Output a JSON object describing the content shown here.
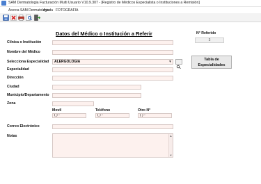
{
  "window": {
    "title": "SAM Dermatologia Facturación Multi Usuario V10.9.307 - [Registro de Médicos Especialista o Instituciones a Remisión]"
  },
  "menu": {
    "items": [
      "Acerca SAM Dermatologia",
      "Ayuda",
      "FOTOGRAFIA"
    ]
  },
  "toolbar": {
    "buttons": [
      "save-icon",
      "delete-icon",
      "print-icon",
      "search-icon",
      "exit-icon"
    ]
  },
  "form": {
    "heading": "Datos del Médico o Institución a Referir",
    "clinic_label": "Clínica o Institución",
    "clinic_value": "",
    "doctor_label": "Nombre del Médico",
    "doctor_value": "",
    "specialty_select_label": "Selecciona Especialidad",
    "specialty_select_value": "ALERGOLOGIA",
    "specialty_label": "Especialidad",
    "specialty_value": "",
    "address_label": "Dirección",
    "address_value": "",
    "city_label": "Ciudad",
    "city_value": "",
    "municipality_label": "Municipio/Departamento",
    "municipality_value": "",
    "zone_label": "Zona",
    "zone_value": "",
    "mobile_label": "Movil",
    "mobile_value": "( )   -",
    "phone_label": "Teléfono",
    "phone_value": "( )   -",
    "other_label": "Otro N°",
    "other_value": "( )   -",
    "email_label": "Correo Electrónico",
    "email_value": "",
    "notes_label": "Notas",
    "notes_value": ""
  },
  "referral": {
    "label": "N° Referido",
    "value": "3"
  },
  "specialties_table_button": {
    "line1": "Tabla de",
    "line2": "Especialidades"
  },
  "colors": {
    "field_bg": "#fdf1ee",
    "field_border": "#d7c9c6",
    "toolbar_bg": "#f3f3f3"
  }
}
